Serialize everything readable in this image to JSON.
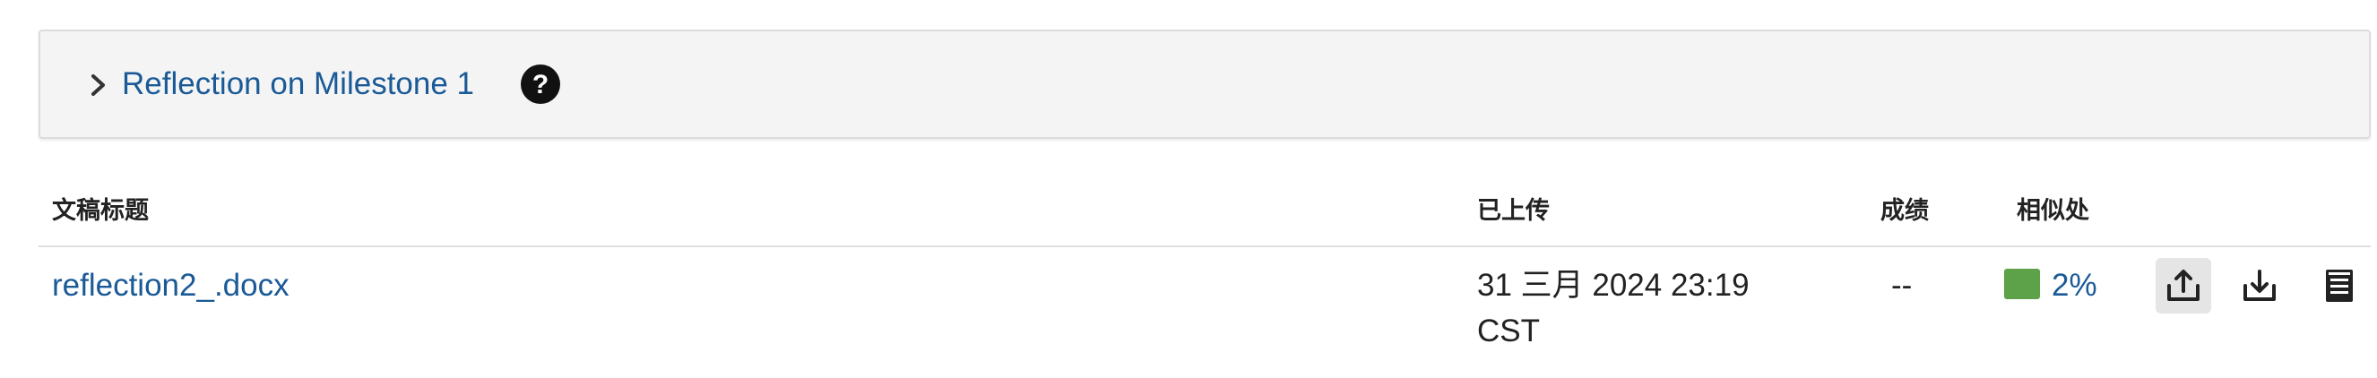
{
  "panel": {
    "title": "Reflection on Milestone 1",
    "icons": [
      "chevron-right-icon",
      "help-icon"
    ]
  },
  "table": {
    "headers": {
      "title": "文稿标题",
      "uploaded": "已上传",
      "grade": "成绩",
      "similarity": "相似处"
    },
    "rows": [
      {
        "filename": "reflection2_.docx",
        "uploaded_date": "31 三月 2024 23:19",
        "uploaded_tz": "CST",
        "grade": "--",
        "similarity": "2%",
        "similarity_color": "#5da149"
      }
    ],
    "actions": [
      "upload-icon",
      "download-icon",
      "document-icon"
    ]
  },
  "colors": {
    "link": "#1a5a97",
    "panel_bg": "#f4f4f4",
    "active_btn_bg": "#e5e5e5"
  }
}
